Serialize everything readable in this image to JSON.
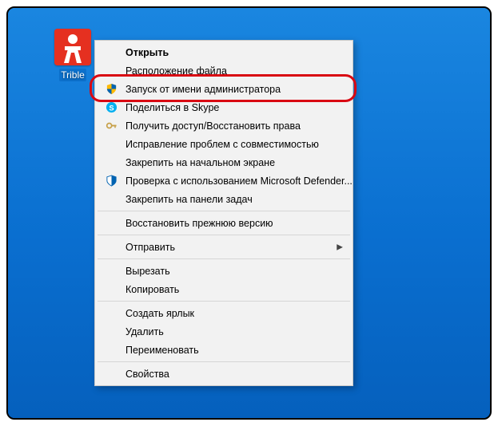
{
  "desktop": {
    "icon_label": "Trible"
  },
  "menu": {
    "open": "Открыть",
    "file_location": "Расположение файла",
    "run_admin": "Запуск от имени администратора",
    "share_skype": "Поделиться в Skype",
    "restore_rights": "Получить доступ/Восстановить права",
    "compat_troubleshoot": "Исправление проблем с совместимостью",
    "pin_start": "Закрепить на начальном экране",
    "defender_scan": "Проверка с использованием Microsoft Defender...",
    "pin_taskbar": "Закрепить на панели задач",
    "restore_prev": "Восстановить прежнюю версию",
    "send_to": "Отправить",
    "cut": "Вырезать",
    "copy": "Копировать",
    "create_shortcut": "Создать ярлык",
    "delete": "Удалить",
    "rename": "Переименовать",
    "properties": "Свойства"
  }
}
